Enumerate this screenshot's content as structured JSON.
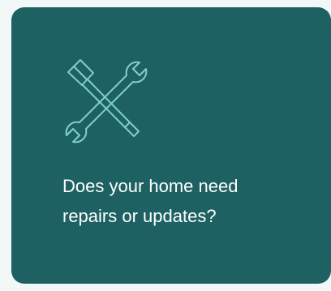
{
  "card": {
    "icon": "tools-icon",
    "question_line1": "Does your home need",
    "question_line2": "repairs or updates?"
  },
  "colors": {
    "page_background": "#f2f8f8",
    "card_background": "#1d6163",
    "icon_stroke": "#7fcfcb",
    "text": "#ffffff"
  }
}
